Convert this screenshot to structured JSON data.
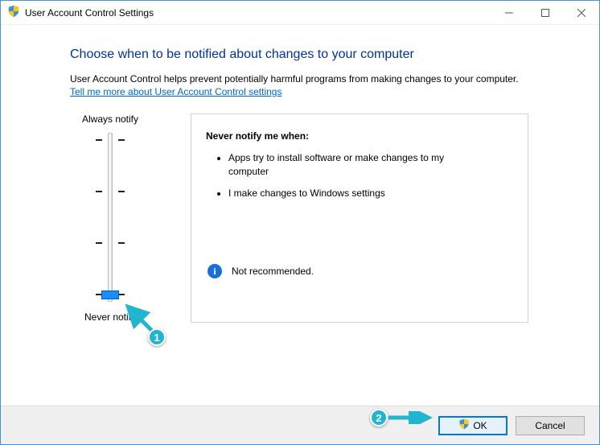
{
  "window": {
    "title": "User Account Control Settings"
  },
  "heading": "Choose when to be notified about changes to your computer",
  "description": "User Account Control helps prevent potentially harmful programs from making changes to your computer.",
  "link_text": "Tell me more about User Account Control settings",
  "slider": {
    "top_label": "Always notify",
    "bottom_label": "Never notify"
  },
  "info": {
    "title": "Never notify me when:",
    "bullets": [
      "Apps try to install software or make changes to my computer",
      "I make changes to Windows settings"
    ],
    "recommendation": "Not recommended."
  },
  "buttons": {
    "ok": "OK",
    "cancel": "Cancel"
  },
  "callouts": {
    "one": "1",
    "two": "2"
  }
}
